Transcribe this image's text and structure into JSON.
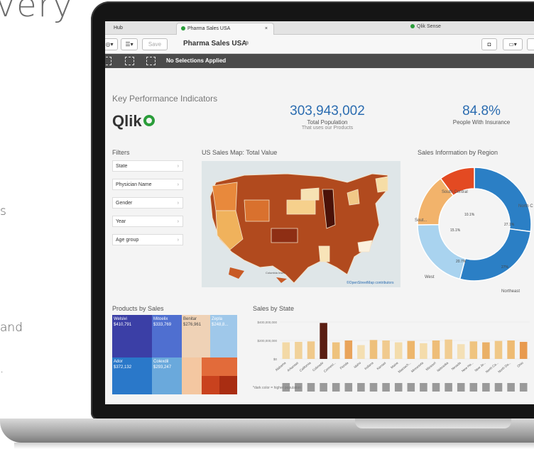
{
  "page": {
    "headline_fragment": "very",
    "side_fragment_1": "s",
    "side_fragment_2": "and",
    "side_fragment_3": "."
  },
  "browser": {
    "tabs": [
      {
        "label": "Hub"
      },
      {
        "label": "Pharma Sales USA"
      }
    ],
    "tab_close": "×",
    "app_header": "Qlik Sense"
  },
  "toolbar": {
    "save_label": "Save",
    "app_title": "Pharma Sales USA",
    "info_icon": "info-icon"
  },
  "selections": {
    "status": "No Selections Applied"
  },
  "sheet": {
    "kpi_title": "Key Performance Indicators",
    "logo_text": "Qlik",
    "kpi1": {
      "value": "303,943,002",
      "label": "Total Population",
      "sub": "That uses our Products"
    },
    "kpi2": {
      "value": "84.8%",
      "label": "People With Insurance"
    },
    "filters_title": "Filters",
    "filters": [
      {
        "label": "State"
      },
      {
        "label": "Physician Name"
      },
      {
        "label": "Gender"
      },
      {
        "label": "Year"
      },
      {
        "label": "Age group"
      }
    ],
    "map_title": "US Sales Map: Total Value",
    "map_credit": "©OpenStreetMap contributors",
    "map_inset": "Columbia Inset",
    "donut_title": "Sales Information by Region",
    "products_title": "Products by Sales",
    "bars_title": "Sales by State",
    "footnote": "*dark color = higher population"
  },
  "colors": {
    "accent": "#2b6cb0",
    "brand_green": "#2a9d3a",
    "selection_bar": "#4b4b4b"
  },
  "chart_data": [
    {
      "type": "pie",
      "title": "Sales Information by Region",
      "labels": [
        "North Central",
        "Northeast",
        "West",
        "South",
        "South Central"
      ],
      "values": [
        27.1,
        27,
        20.7,
        15.1,
        10.1
      ],
      "value_labels": [
        "27.1%",
        "27%",
        "20.7%",
        "15.1%",
        "10.1%"
      ],
      "label_text": [
        "North C",
        "Northeast",
        "West",
        "Sout...",
        "South Central"
      ],
      "colors": [
        "#2b7fc5",
        "#2b7fc5",
        "#a9d3ef",
        "#f2b36b",
        "#e34a22"
      ]
    },
    {
      "type": "heatmap",
      "title": "Products by Sales",
      "cells": [
        {
          "name": "Welsivi",
          "value": "$410,791",
          "color": "#3b3fa6"
        },
        {
          "name": "Mitoelix",
          "value": "$333,769",
          "color": "#4f6fd0"
        },
        {
          "name": "Benitar",
          "value": "$276,961",
          "color": "#efd2b6"
        },
        {
          "name": "Zepla",
          "value": "$248,8...",
          "color": "#9fc8ea"
        },
        {
          "name": "Ador",
          "value": "$372,132",
          "color": "#2a78c9"
        },
        {
          "name": "Colexdil",
          "value": "$293,247",
          "color": "#6aa9dc"
        }
      ]
    },
    {
      "type": "bar",
      "title": "Sales by State",
      "y_tick_labels": [
        "$400,000,000",
        "$200,000,000",
        "$0"
      ],
      "ylim": [
        0,
        400000000
      ],
      "categories": [
        "Alabama",
        "Arkansas",
        "California",
        "Colorado",
        "Connect...",
        "Florida",
        "Idaho",
        "Indiana",
        "Kansas",
        "Maine",
        "Massach...",
        "Minnesota",
        "Missouri",
        "Nebraska",
        "Nevada",
        "New Ha...",
        "New Je...",
        "North Ca...",
        "North Da...",
        "Ohio"
      ],
      "values": [
        180000000,
        185000000,
        190000000,
        390000000,
        180000000,
        200000000,
        150000000,
        205000000,
        200000000,
        180000000,
        195000000,
        170000000,
        200000000,
        210000000,
        160000000,
        190000000,
        180000000,
        195000000,
        200000000,
        185000000
      ],
      "bar_colors": [
        "#f3d9a6",
        "#f1d29a",
        "#f0c98b",
        "#5a1d12",
        "#eec27d",
        "#e9a35a",
        "#f4dfb2",
        "#eec07a",
        "#f0ca8e",
        "#f3dcab",
        "#edb66c",
        "#f4dcab",
        "#eebd78",
        "#f1cd92",
        "#f4e0b6",
        "#efc480",
        "#eab067",
        "#f0c887",
        "#eebb73",
        "#e89a4f"
      ]
    }
  ]
}
